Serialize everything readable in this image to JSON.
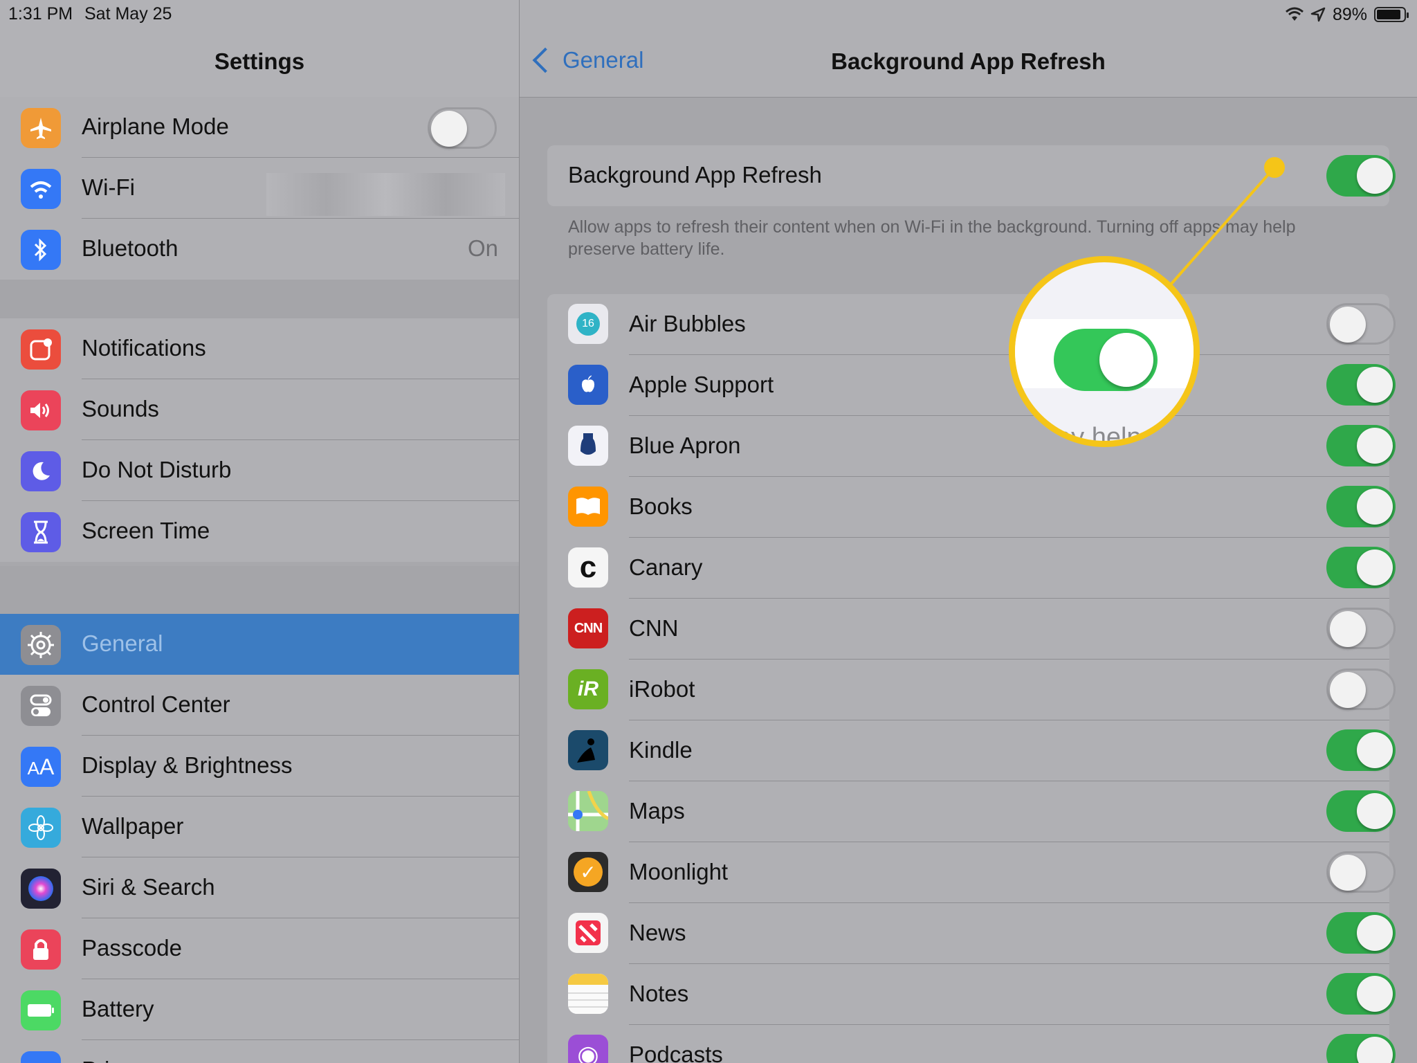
{
  "status_bar": {
    "time": "1:31 PM",
    "date": "Sat May 25",
    "battery": "89%",
    "battery_level": 0.89
  },
  "sidebar": {
    "title": "Settings",
    "sections": [
      [
        {
          "label": "Airplane Mode",
          "icon": "airplane-icon",
          "color": "#f09a37",
          "toggle": false
        },
        {
          "label": "Wi-Fi",
          "icon": "wifi-icon",
          "color": "#3478f6",
          "detail": ""
        },
        {
          "label": "Bluetooth",
          "icon": "bluetooth-icon",
          "color": "#3478f6",
          "detail": "On"
        }
      ],
      [
        {
          "label": "Notifications",
          "icon": "notifications-icon",
          "color": "#eb4d3d"
        },
        {
          "label": "Sounds",
          "icon": "sounds-icon",
          "color": "#eb445a"
        },
        {
          "label": "Do Not Disturb",
          "icon": "moon-icon",
          "color": "#5e5ce6"
        },
        {
          "label": "Screen Time",
          "icon": "hourglass-icon",
          "color": "#5e5ce6"
        }
      ],
      [
        {
          "label": "General",
          "icon": "gear-icon",
          "color": "#8e8e93",
          "selected": true
        },
        {
          "label": "Control Center",
          "icon": "switches-icon",
          "color": "#8e8e93"
        },
        {
          "label": "Display & Brightness",
          "icon": "text-size-icon",
          "color": "#3478f6"
        },
        {
          "label": "Wallpaper",
          "icon": "flower-icon",
          "color": "#35aadc"
        },
        {
          "label": "Siri & Search",
          "icon": "siri-icon",
          "color": "#222233"
        },
        {
          "label": "Passcode",
          "icon": "lock-icon",
          "color": "#eb445a"
        },
        {
          "label": "Battery",
          "icon": "battery-icon",
          "color": "#4cd964"
        },
        {
          "label": "Privacy",
          "icon": "hand-icon",
          "color": "#3478f6"
        }
      ]
    ]
  },
  "detail": {
    "back_label": "General",
    "title": "Background App Refresh",
    "master": {
      "label": "Background App Refresh",
      "on": true
    },
    "footer": "Allow apps to refresh their content when on Wi-Fi in the background. Turning off apps may help preserve battery life.",
    "apps": [
      {
        "name": "Air Bubbles",
        "on": false,
        "icon": "air-bubbles-icon",
        "color": "#e9e9ee",
        "glyph": "16"
      },
      {
        "name": "Apple Support",
        "on": true,
        "icon": "apple-support-icon",
        "color": "#2a5fc9",
        "glyph": ""
      },
      {
        "name": "Blue Apron",
        "on": true,
        "icon": "blue-apron-icon",
        "color": "#f2f2f7",
        "glyph": ""
      },
      {
        "name": "Books",
        "on": true,
        "icon": "books-icon",
        "color": "#ff9500",
        "glyph": ""
      },
      {
        "name": "Canary",
        "on": true,
        "icon": "canary-icon",
        "color": "#f5f5f5",
        "glyph": "c"
      },
      {
        "name": "CNN",
        "on": false,
        "icon": "cnn-icon",
        "color": "#cc1f1f",
        "glyph": "CNN"
      },
      {
        "name": "iRobot",
        "on": false,
        "icon": "irobot-icon",
        "color": "#6ab023",
        "glyph": "iR"
      },
      {
        "name": "Kindle",
        "on": true,
        "icon": "kindle-icon",
        "color": "#1b4a6b",
        "glyph": ""
      },
      {
        "name": "Maps",
        "on": true,
        "icon": "maps-icon",
        "color": "#8fd18a",
        "glyph": ""
      },
      {
        "name": "Moonlight",
        "on": false,
        "icon": "moonlight-icon",
        "color": "#2b2b2b",
        "glyph": "✓"
      },
      {
        "name": "News",
        "on": true,
        "icon": "news-icon",
        "color": "#f4f4f4",
        "glyph": "N"
      },
      {
        "name": "Notes",
        "on": true,
        "icon": "notes-icon",
        "color": "#f7f7f7",
        "glyph": ""
      },
      {
        "name": "Podcasts",
        "on": true,
        "icon": "podcasts-icon",
        "color": "#9b4ed6",
        "glyph": "◉"
      }
    ]
  },
  "callout": {
    "zoom_text": "ay help",
    "accent": "#f5c518"
  }
}
